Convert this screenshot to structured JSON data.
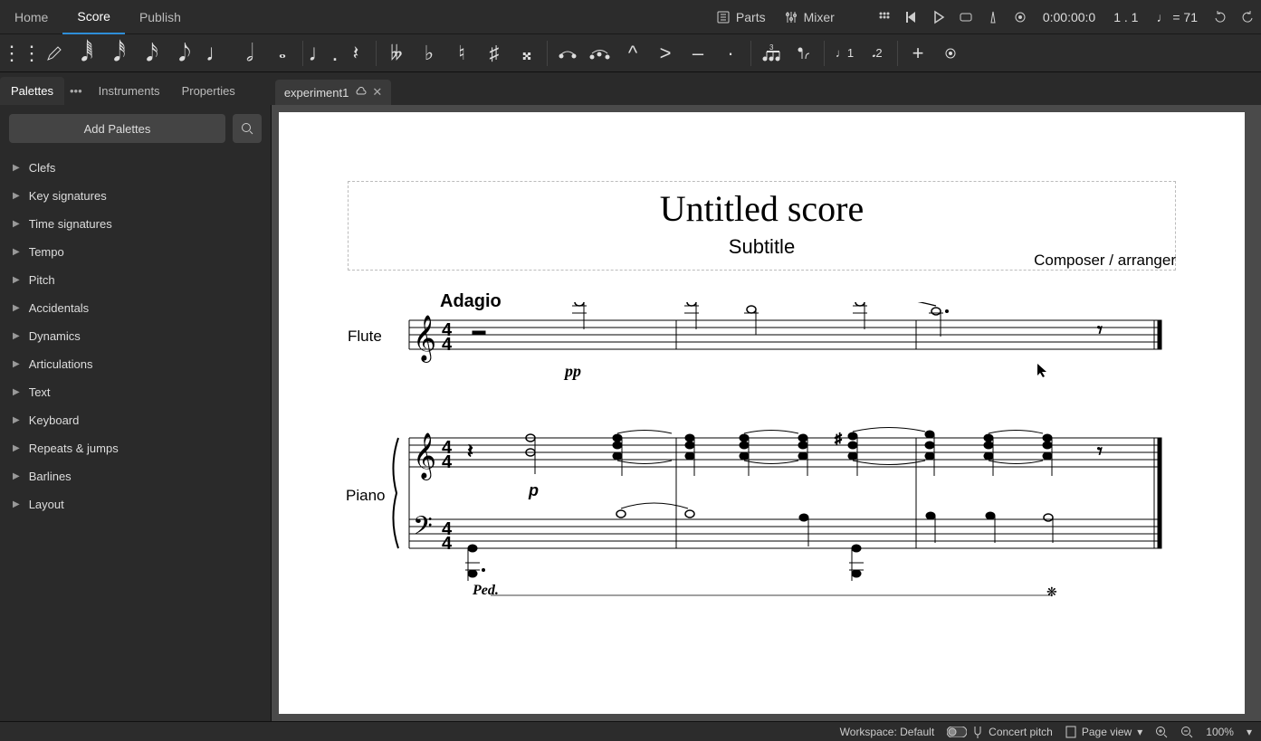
{
  "topbar": {
    "tabs": [
      "Home",
      "Score",
      "Publish"
    ],
    "active_tab": 1,
    "parts_label": "Parts",
    "mixer_label": "Mixer",
    "timecode": "0:00:00:0",
    "position": "1 . 1",
    "tempo_eq": "= 71"
  },
  "filetab": {
    "name": "experiment1"
  },
  "paneltabs": {
    "items": [
      "Palettes",
      "Instruments",
      "Properties"
    ],
    "active": 0
  },
  "sidebar": {
    "add_label": "Add Palettes",
    "palettes": [
      "Clefs",
      "Key signatures",
      "Time signatures",
      "Tempo",
      "Pitch",
      "Accidentals",
      "Dynamics",
      "Articulations",
      "Text",
      "Keyboard",
      "Repeats & jumps",
      "Barlines",
      "Layout"
    ]
  },
  "score": {
    "title": "Untitled score",
    "subtitle": "Subtitle",
    "composer": "Composer / arranger",
    "tempo_text": "Adagio",
    "instruments": [
      "Flute",
      "Piano"
    ],
    "dyn_pp": "pp",
    "dyn_p": "p",
    "pedal": "Ped."
  },
  "statusbar": {
    "workspace": "Workspace: Default",
    "concert": "Concert pitch",
    "view": "Page view",
    "zoom": "100%"
  }
}
